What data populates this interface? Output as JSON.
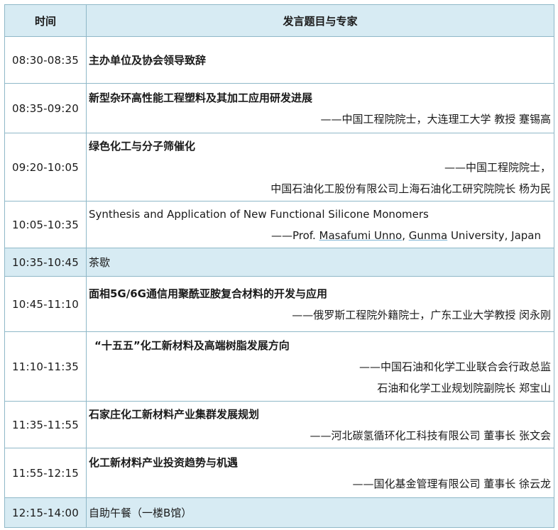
{
  "header": {
    "time": "时间",
    "topic": "发言题目与专家"
  },
  "rows": [
    {
      "time": "08:30-08:35",
      "title": "主办单位及协会领导致辞"
    },
    {
      "time": "08:35-09:20",
      "title": "新型杂环高性能工程塑料及其加工应用研发进展",
      "speaker1": "——中国工程院院士，大连理工大学 教授  蹇锡高"
    },
    {
      "time": "09:20-10:05",
      "title": "绿色化工与分子筛催化",
      "speaker1": "——中国工程院院士，",
      "speaker2": "中国石油化工股份有限公司上海石油化工研究院院长 杨为民"
    },
    {
      "time": "10:05-10:35",
      "title": "Synthesis and Application of New Functional Silicone Monomers",
      "speaker1_prefix": "——Prof. ",
      "speaker1_name": "Masafumi Unno",
      "speaker1_sep": ", ",
      "speaker1_org": "Gunma",
      "speaker1_suffix": " University, Japan"
    },
    {
      "time": "10:35-10:45",
      "title": "茶歇"
    },
    {
      "time": "10:45-11:10",
      "title": "面相5G/6G通信用聚酰亚胺复合材料的开发与应用",
      "speaker1": "——俄罗斯工程院外籍院士，广东工业大学教授 闵永刚"
    },
    {
      "time": "11:10-11:35",
      "title": "“十五五”化工新材料及高端树脂发展方向",
      "speaker1": "——中国石油和化学工业联合会行政总监",
      "speaker2": "石油和化学工业规划院副院长 郑宝山"
    },
    {
      "time": "11:35-11:55",
      "title": "石家庄化工新材料产业集群发展规划",
      "speaker1": "——河北碳氢循环化工科技有限公司 董事长 张文会"
    },
    {
      "time": "11:55-12:15",
      "title": "化工新材料产业投资趋势与机遇",
      "speaker1": "——国化基金管理有限公司 董事长 徐云龙"
    },
    {
      "time": "12:15-14:00",
      "title": "自助午餐（一楼B馆）"
    }
  ]
}
